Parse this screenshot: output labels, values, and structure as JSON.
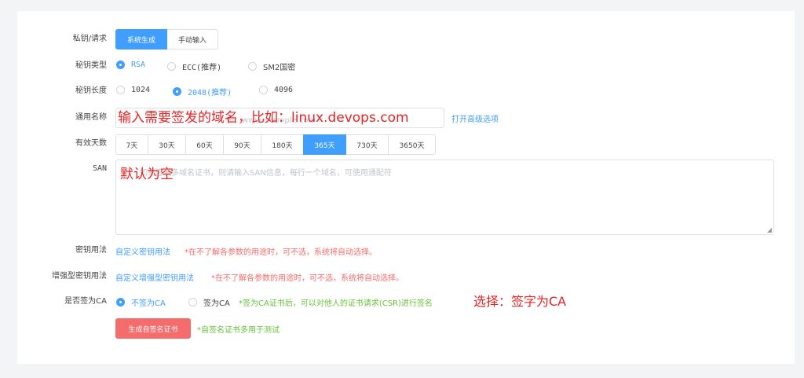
{
  "form": {
    "key_request": {
      "label": "私钥/请求",
      "options": [
        {
          "label": "系统生成",
          "active": true
        },
        {
          "label": "手动输入",
          "active": false
        }
      ]
    },
    "key_type": {
      "label": "秘钥类型",
      "options": [
        {
          "label": "RSA",
          "selected": true
        },
        {
          "label": "ECC(推荐)",
          "selected": false
        },
        {
          "label": "SM2国密",
          "selected": false
        }
      ]
    },
    "key_length": {
      "label": "秘钥长度",
      "options": [
        {
          "label": "1024",
          "selected": false
        },
        {
          "label": "2048(推荐)",
          "selected": true
        },
        {
          "label": "4096",
          "selected": false
        }
      ]
    },
    "common_name": {
      "label": "通用名称",
      "placeholder": "如：www.example.com",
      "advanced_link": "打开高级选项"
    },
    "validity": {
      "label": "有效天数",
      "options": [
        {
          "label": "7天",
          "active": false
        },
        {
          "label": "30天",
          "active": false
        },
        {
          "label": "60天",
          "active": false
        },
        {
          "label": "90天",
          "active": false
        },
        {
          "label": "180天",
          "active": false
        },
        {
          "label": "365天",
          "active": true
        },
        {
          "label": "730天",
          "active": false
        },
        {
          "label": "3650天",
          "active": false
        }
      ]
    },
    "san": {
      "label": "SAN",
      "placeholder": "如需签发多域名证书，则请输入SAN信息，每行一个域名，可使用通配符"
    },
    "key_usage": {
      "label": "密钥用法",
      "link": "自定义密钥用法",
      "hint": "*在不了解各参数的用途时，可不选，系统将自动选择。"
    },
    "ext_key_usage": {
      "label": "增强型密钥用法",
      "link": "自定义增强型密钥用法",
      "hint": "*在不了解各参数的用途时，可不选，系统将自动选择。"
    },
    "sign_as_ca": {
      "label": "是否签为CA",
      "options": [
        {
          "label": "不签为CA",
          "selected": true
        },
        {
          "label": "签为CA",
          "selected": false
        }
      ],
      "hint": "*签为CA证书后，可以对他人的证书请求(CSR)进行签名"
    },
    "submit": {
      "label": "生成自签名证书",
      "hint": "*自签名证书多用于测试"
    }
  },
  "annotations": {
    "common_name": "输入需要签发的域名，比如：linux.devops.com",
    "san": "默认为空",
    "ca": "选择：签字为CA"
  },
  "colors": {
    "primary": "#409eff",
    "danger": "#f56c6c",
    "success": "#67c23a",
    "annotation": "#e82424"
  }
}
